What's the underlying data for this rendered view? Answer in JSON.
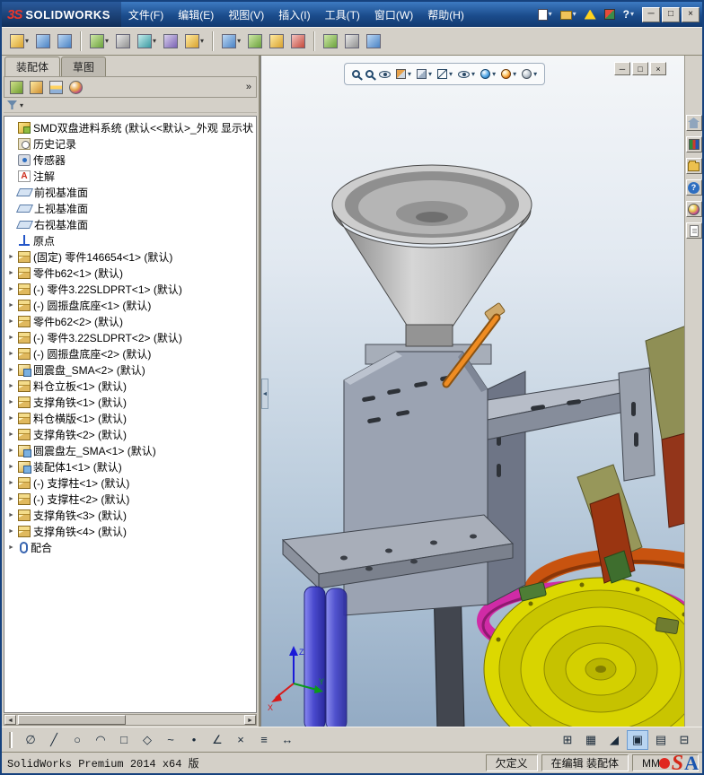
{
  "glyphs": {
    "dropdown": "▾",
    "expand": "►",
    "chevron_double": "»",
    "minimize": "─",
    "restore": "□",
    "close": "×",
    "scroll_left": "◄",
    "scroll_right": "►",
    "panel_collapse": "◄"
  },
  "titlebar": {
    "logo_mark": "3S",
    "logo_text": "SOLIDWORKS",
    "menus": [
      "文件(F)",
      "编辑(E)",
      "视图(V)",
      "插入(I)",
      "工具(T)",
      "窗口(W)",
      "帮助(H)"
    ],
    "help": "?"
  },
  "quick_toolbar": {
    "buttons": [
      "new-document",
      "open-document",
      "solidworks-resources",
      "solidworks-rx",
      "help"
    ]
  },
  "assembly_toolbar": {
    "buttons": [
      "insert-components",
      "edit-component",
      "mate",
      "linear-component-pattern",
      "smart-fasteners",
      "move-component",
      "show-hidden-components",
      "assembly-features",
      "reference-geometry",
      "new-motion-study",
      "bill-of-materials",
      "exploded-view",
      "interference-detection",
      "instant3d",
      "large-assembly-mode"
    ]
  },
  "left_panel": {
    "tabs": [
      {
        "label": "装配体",
        "active": true
      },
      {
        "label": "草图",
        "active": false
      }
    ],
    "tools": [
      "featuremanager-tree",
      "propertymanager",
      "configurationmanager",
      "displaymanager"
    ],
    "overflow_chevron": "»",
    "tree": [
      {
        "icon": "assembly",
        "label": "SMD双盘进料系统 (默认<<默认>_外观 显示状"
      },
      {
        "icon": "history",
        "label": "历史记录"
      },
      {
        "icon": "sensor",
        "label": "传感器"
      },
      {
        "icon": "annotations",
        "label": "注解"
      },
      {
        "icon": "plane",
        "label": "前视基准面"
      },
      {
        "icon": "plane",
        "label": "上视基准面"
      },
      {
        "icon": "plane",
        "label": "右视基准面"
      },
      {
        "icon": "origin",
        "label": "原点"
      },
      {
        "icon": "part",
        "label": "(固定) 零件146654<1> (默认)"
      },
      {
        "icon": "part",
        "label": "零件b62<1> (默认)"
      },
      {
        "icon": "part",
        "label": "(-) 零件3.22SLDPRT<1> (默认)"
      },
      {
        "icon": "part",
        "label": "(-) 圆振盘底座<1> (默认)"
      },
      {
        "icon": "part",
        "label": "零件b62<2> (默认)"
      },
      {
        "icon": "part",
        "label": "(-) 零件3.22SLDPRT<2> (默认)"
      },
      {
        "icon": "part",
        "label": "(-) 圆振盘底座<2> (默认)"
      },
      {
        "icon": "subassembly",
        "label": "圆震盘_SMA<2> (默认)"
      },
      {
        "icon": "part",
        "label": "料仓立板<1> (默认)"
      },
      {
        "icon": "part",
        "label": "支撑角铁<1> (默认)"
      },
      {
        "icon": "part",
        "label": "料仓横版<1> (默认)"
      },
      {
        "icon": "part",
        "label": "支撑角铁<2> (默认)"
      },
      {
        "icon": "subassembly",
        "label": "圆震盘左_SMA<1> (默认)"
      },
      {
        "icon": "subassembly",
        "label": "装配体1<1> (默认)"
      },
      {
        "icon": "part",
        "label": "(-) 支撑柱<1> (默认)"
      },
      {
        "icon": "part",
        "label": "(-) 支撑柱<2> (默认)"
      },
      {
        "icon": "part",
        "label": "支撑角铁<3> (默认)"
      },
      {
        "icon": "part",
        "label": "支撑角铁<4> (默认)"
      },
      {
        "icon": "mates",
        "label": "配合"
      }
    ]
  },
  "viewport": {
    "hud_buttons": [
      "zoom-to-fit",
      "zoom-to-area",
      "previous-view",
      "section-view",
      "view-orientation",
      "display-style",
      "hide-show-items",
      "edit-appearance",
      "apply-scene",
      "view-settings"
    ],
    "doc_window_buttons": [
      "minimize",
      "restore",
      "close"
    ],
    "triad": {
      "x": "X",
      "y": "Y",
      "z": "Z"
    },
    "model_colors": {
      "funnel": "#cdcdcd",
      "frame": "#9ba3b2",
      "columns": "#4a4ace",
      "bowl_yellow": "#dcd800",
      "ring_magenta": "#d02ba6",
      "ring_orange": "#c8530f",
      "rod_orange": "#ef8c22",
      "support_red": "#9a3511",
      "bracket_olive": "#97975a"
    }
  },
  "taskpane": {
    "buttons": [
      "solidworks-resources",
      "design-library",
      "file-explorer",
      "view-palette",
      "appearances-scenes",
      "custom-properties"
    ]
  },
  "sketch_toolbar": {
    "tools": [
      {
        "name": "smart-dimension",
        "glyph": "∅"
      },
      {
        "name": "line",
        "glyph": "╱"
      },
      {
        "name": "circle",
        "glyph": "○"
      },
      {
        "name": "arc",
        "glyph": "◠"
      },
      {
        "name": "rectangle",
        "glyph": "□"
      },
      {
        "name": "polygon",
        "glyph": "◇"
      },
      {
        "name": "spline",
        "glyph": "~"
      },
      {
        "name": "point",
        "glyph": "•"
      },
      {
        "name": "angle",
        "glyph": "∠"
      },
      {
        "name": "trim-entities",
        "glyph": "×"
      },
      {
        "name": "offset-entities",
        "glyph": "≡"
      },
      {
        "name": "mirror-entities",
        "glyph": "↔"
      }
    ],
    "view_tools": [
      {
        "name": "grid",
        "glyph": "⊞"
      },
      {
        "name": "snap",
        "glyph": "▦"
      },
      {
        "name": "shaded-sketch-contours",
        "glyph": "◢"
      },
      {
        "name": "sketch-picture",
        "glyph": "▣",
        "active": true
      },
      {
        "name": "rapid-sketch",
        "glyph": "▤"
      },
      {
        "name": "table",
        "glyph": "⊟"
      }
    ]
  },
  "statusbar": {
    "product": "SolidWorks Premium 2014 x64 版",
    "status": "欠定义",
    "editing": "在编辑 装配体",
    "units": "MMG"
  },
  "watermark": {
    "s": "S",
    "a": "A"
  }
}
